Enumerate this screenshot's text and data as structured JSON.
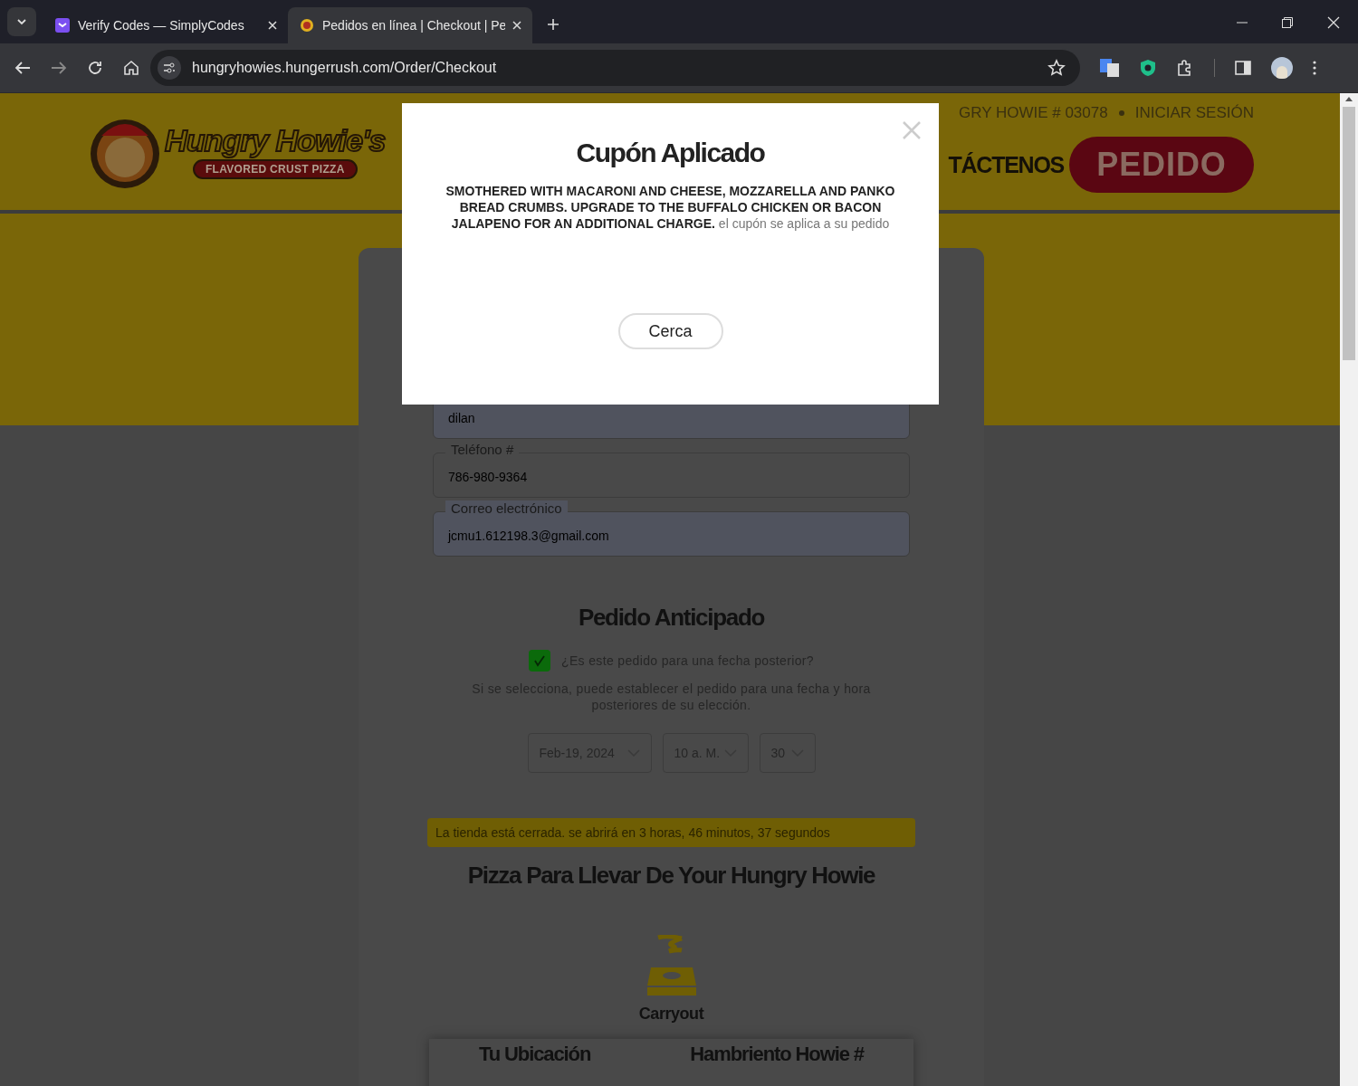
{
  "browser": {
    "tabs": [
      {
        "title": "Verify Codes — SimplyCodes",
        "selected": false
      },
      {
        "title": "Pedidos en línea | Checkout | Pe",
        "selected": true
      }
    ],
    "url": "hungryhowies.hungerrush.com/Order/Checkout"
  },
  "header": {
    "logo": {
      "name": "Hungry Howie's",
      "tagline": "FLAVORED CRUST PIZZA"
    },
    "store": "GRY HOWIE # 03078",
    "login": "INICIAR SESIÓN",
    "nav_item": "TÁCTENOS",
    "order_button": "PEDIDO"
  },
  "form": {
    "fields": [
      {
        "value": "dilan",
        "autofilled": true
      },
      {
        "label": "Teléfono #",
        "value": "786-980-9364",
        "autofilled": false
      },
      {
        "label": "Correo electrónico",
        "value": "jcmu1.612198.3@gmail.com",
        "autofilled": true
      }
    ]
  },
  "advance_order": {
    "title": "Pedido Anticipado",
    "checkbox": {
      "label": "¿Es este pedido para una fecha posterior?",
      "checked": true
    },
    "description": "Si se selecciona, puede establecer el pedido para una fecha y hora posteriores de su elección.",
    "selects": [
      "Feb-19, 2024",
      "10 a. M.",
      "30"
    ]
  },
  "notice": "La tienda está cerrada. se abrirá en 3 horas, 46 minutos, 37 segundos",
  "carryout": {
    "title": "Pizza Para Llevar De Your Hungry Howie",
    "option": "Carryout"
  },
  "location_panel": {
    "headings": [
      "Tu Ubicación",
      "Hambriento Howie #"
    ]
  },
  "modal": {
    "title": "Cupón Aplicado",
    "body": "**SMOTHERED WITH MACARONI AND CHEESE, MOZZARELLA AND PANKO BREAD CRUMBS. UPGRADE TO THE BUFFALO CHICKEN OR BACON JALAPENO FOR AN ADDITIONAL CHARGE.** el cupón se aplica a su pedido",
    "button": "Cerca"
  }
}
